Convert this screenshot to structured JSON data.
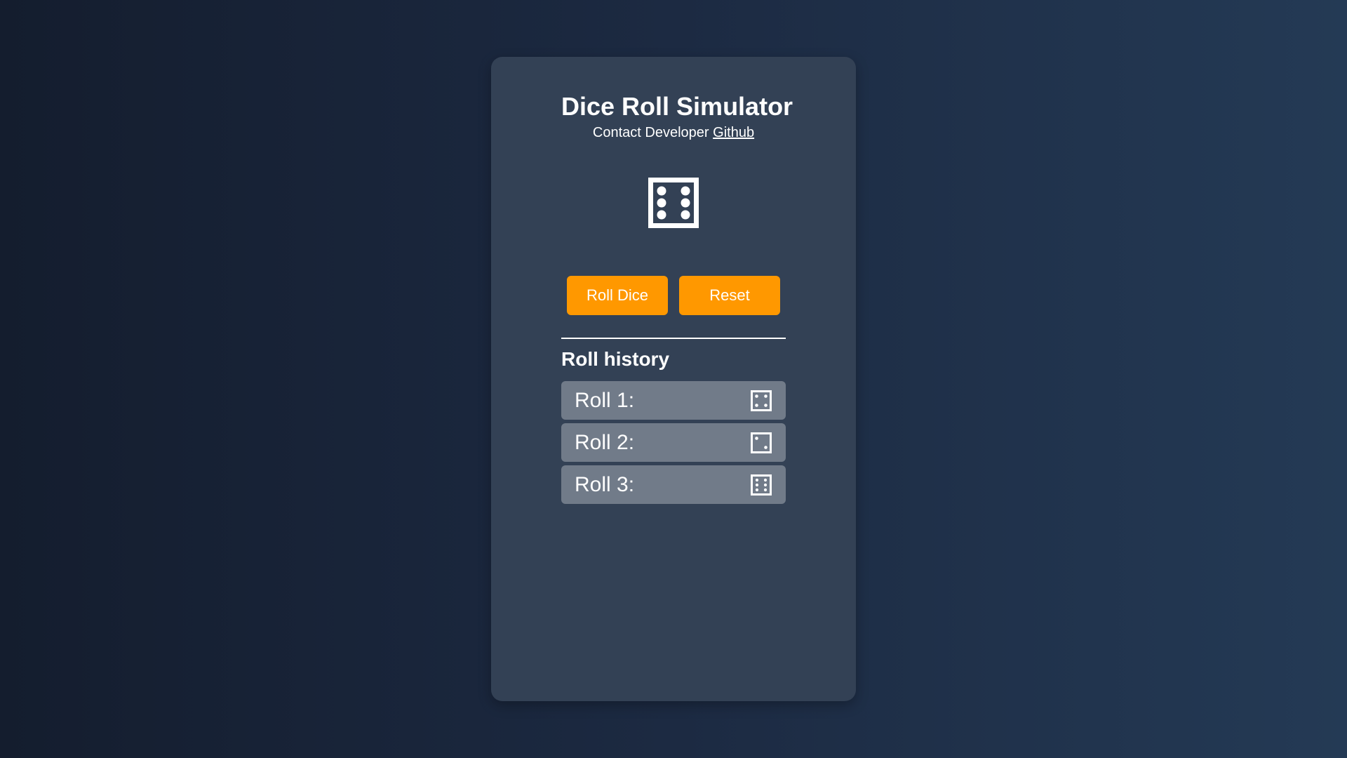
{
  "header": {
    "title": "Dice Roll Simulator",
    "contact_prefix": "Contact Developer",
    "contact_link": "Github"
  },
  "current_roll": {
    "value": 6,
    "icon": "dice-six-icon"
  },
  "controls": {
    "roll_label": "Roll Dice",
    "reset_label": "Reset"
  },
  "history": {
    "title": "Roll history",
    "items": [
      {
        "label": "Roll 1:",
        "value": 4,
        "icon": "dice-four-icon"
      },
      {
        "label": "Roll 2:",
        "value": 2,
        "icon": "dice-two-icon"
      },
      {
        "label": "Roll 3:",
        "value": 6,
        "icon": "dice-six-icon"
      }
    ]
  },
  "colors": {
    "background_start": "#141d2e",
    "background_end": "#243a55",
    "card": "#334155",
    "accent": "#ff9800",
    "history_item": "#717b89",
    "text": "#ffffff"
  }
}
